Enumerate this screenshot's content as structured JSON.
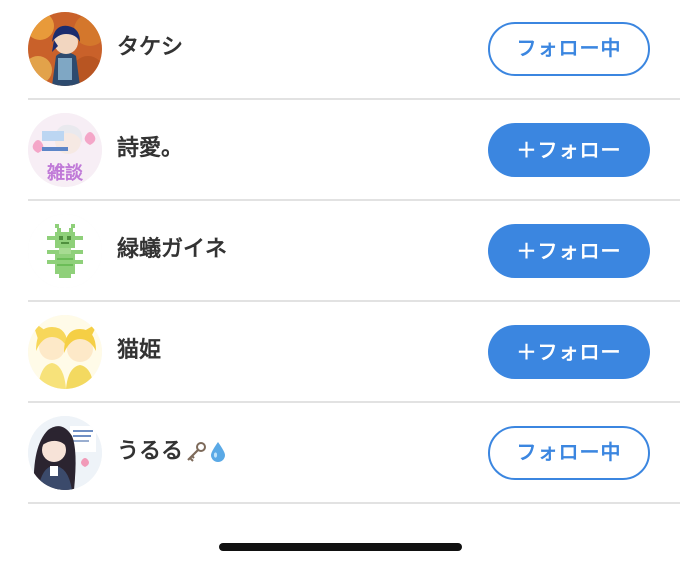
{
  "users": [
    {
      "name": "タケシ",
      "button_label": "フォロー中",
      "following": true
    },
    {
      "name": "詩愛。",
      "button_label": "＋フォロー",
      "following": false,
      "avatar_text": "雑談"
    },
    {
      "name": "緑蟻ガイネ",
      "button_label": "＋フォロー",
      "following": false
    },
    {
      "name": "猫姫",
      "button_label": "＋フォロー",
      "following": false
    },
    {
      "name": "うるる",
      "name_emoji": [
        "key-emoji",
        "droplet-emoji"
      ],
      "button_label": "フォロー中",
      "following": true
    }
  ],
  "colors": {
    "accent": "#3b86e0",
    "divider": "#e2e2e2",
    "name_text": "#333333"
  }
}
